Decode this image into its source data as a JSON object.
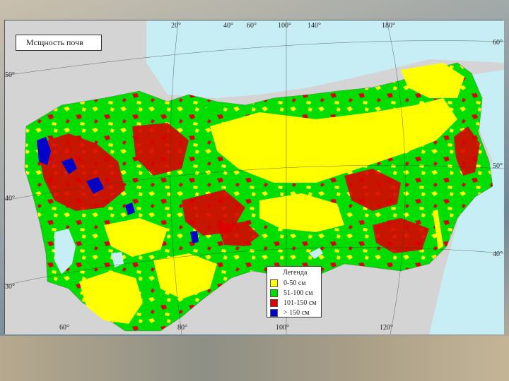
{
  "title": "Мсщность почв",
  "legend": {
    "title": "Легенда",
    "items": [
      {
        "label": "0-50 см",
        "color": "#ffff00"
      },
      {
        "label": "51-100 см",
        "color": "#00dd00"
      },
      {
        "label": "101-150 см",
        "color": "#dd0000"
      },
      {
        "label": "> 150 см",
        "color": "#0000cc"
      }
    ]
  },
  "colors": {
    "land": "#00dd00",
    "sea": "#c8eef5",
    "outside": "#d4d4d4",
    "grid": "#333333"
  },
  "top_longitudes": [
    "20°",
    "40°",
    "60°",
    "100°",
    "140°",
    "180°"
  ],
  "bottom_longitudes": [
    "60°",
    "80°",
    "100°",
    "120°"
  ],
  "left_latitudes": [
    "50°",
    "40°",
    "30°"
  ],
  "right_latitudes": [
    "60°",
    "50°",
    "40°"
  ]
}
